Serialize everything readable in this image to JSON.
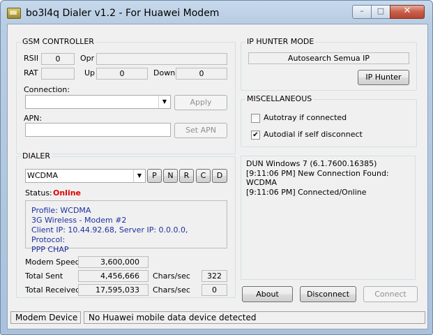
{
  "window": {
    "title": "bo3l4q Dialer v1.2 - For Huawei Modem",
    "min_glyph": "–",
    "max_glyph": "□",
    "close_glyph": "✕"
  },
  "gsm": {
    "title": "GSM CONTROLLER",
    "rssi_label": "RSII",
    "rssi_value": "0",
    "opr_label": "Opr",
    "opr_value": "",
    "rat_label": "RAT",
    "rat_value": "",
    "up_label": "Up",
    "up_value": "0",
    "down_label": "Down",
    "down_value": "0",
    "connection_label": "Connection:",
    "connection_value": "",
    "apply_label": "Apply",
    "apn_label": "APN:",
    "apn_value": "",
    "set_apn_label": "Set APN"
  },
  "ip_hunter": {
    "title": "IP HUNTER MODE",
    "mode_value": "Autosearch Semua IP",
    "button_label": "IP Hunter"
  },
  "misc": {
    "title": "MISCELLANEOUS",
    "autotray_label": "Autotray if connected",
    "autotray_checked": false,
    "autodial_label": "Autodial if self disconnect",
    "autodial_checked": true,
    "check_glyph": "✔"
  },
  "dialer": {
    "title": "DIALER",
    "network_mode": "WCDMA",
    "mode_buttons": [
      "P",
      "N",
      "R",
      "C",
      "D"
    ],
    "status_label": "Status:",
    "status_value": "Online",
    "status_color": "#e00000",
    "info_lines": [
      "Profile: WCDMA",
      "3G Wireless - Modem #2",
      "Client IP: 10.44.92.68,  Server IP: 0.0.0.0,  Protocol:",
      "PPP CHAP"
    ],
    "modem_speed_label": "Modem Speed",
    "modem_speed_value": "3,600,000",
    "total_sent_label": "Total Sent",
    "total_sent_value": "4,456,666",
    "total_received_label": "Total Received",
    "total_received_value": "17,595,033",
    "chars_sec_label": "Chars/sec",
    "sent_chars_sec": "322",
    "received_chars_sec": "0"
  },
  "log": {
    "lines": [
      "DUN Windows 7  (6.1.7600.16385)",
      "[9:11:06 PM]  New Connection Found: WCDMA",
      "[9:11:06 PM]  Connected/Online"
    ]
  },
  "actions": {
    "about": "About",
    "disconnect": "Disconnect",
    "connect": "Connect"
  },
  "status_bar": {
    "pane1": "Modem Device",
    "pane2": "No Huawei mobile data device detected"
  },
  "icons": {
    "app": "modem-app-icon",
    "dropdown": "chevron-down-icon",
    "check": "check-icon"
  }
}
